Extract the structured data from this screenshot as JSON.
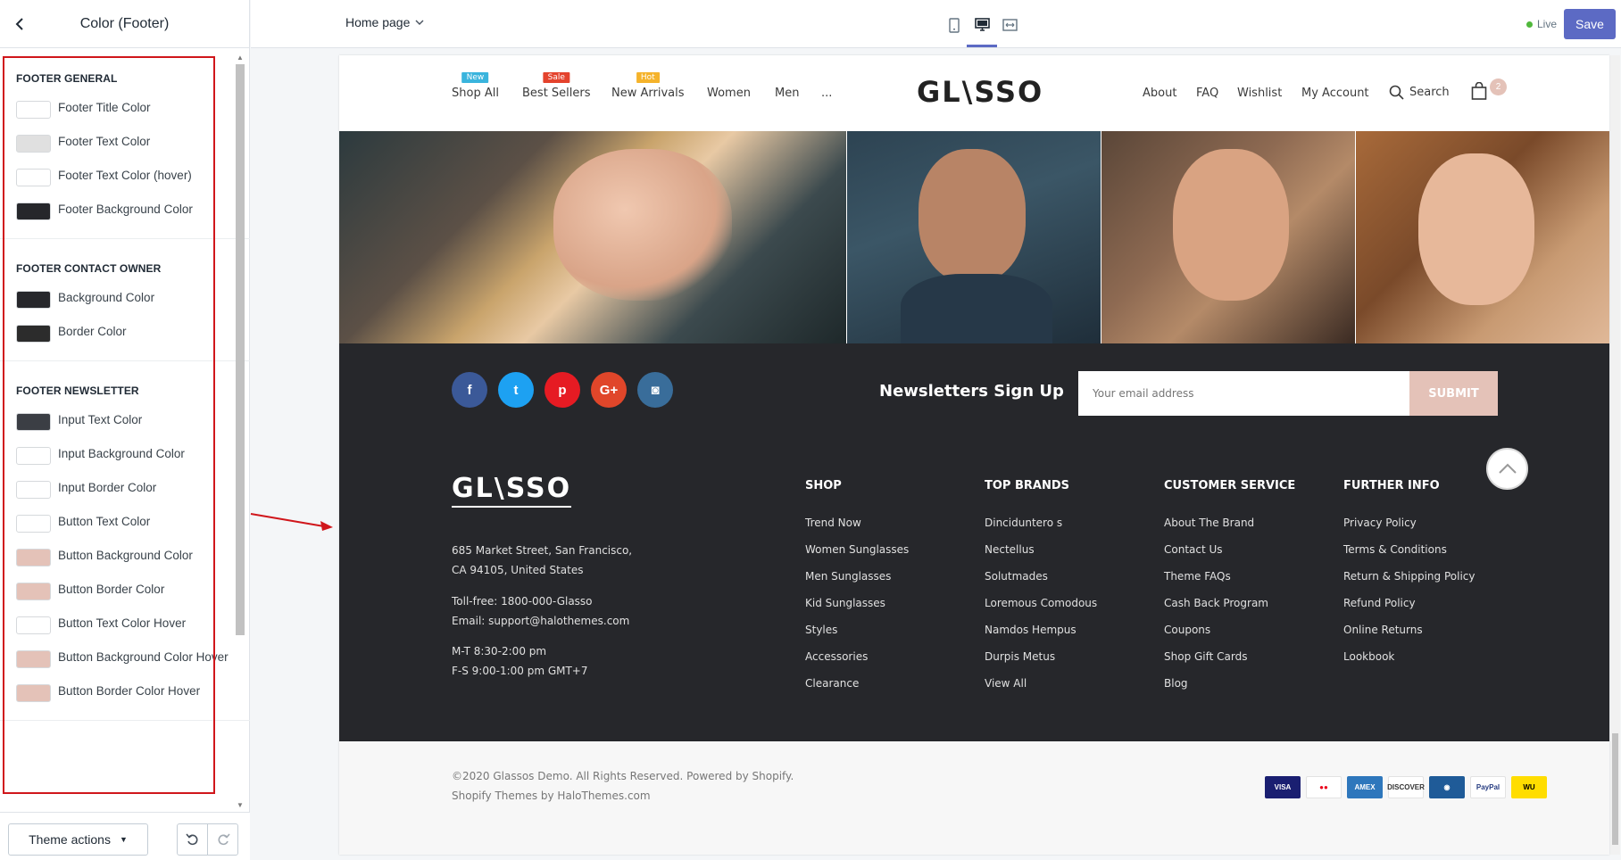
{
  "sidebar": {
    "title": "Color (Footer)",
    "sections": [
      {
        "title": "FOOTER GENERAL",
        "items": [
          {
            "label": "Footer Title Color",
            "color": "#ffffff"
          },
          {
            "label": "Footer Text Color",
            "color": "#e0e0e0"
          },
          {
            "label": "Footer Text Color (hover)",
            "color": "#ffffff"
          },
          {
            "label": "Footer Background Color",
            "color": "#26272b"
          }
        ]
      },
      {
        "title": "FOOTER CONTACT OWNER",
        "items": [
          {
            "label": "Background Color",
            "color": "#26272b"
          },
          {
            "label": "Border Color",
            "color": "#2c2c2c"
          }
        ]
      },
      {
        "title": "FOOTER NEWSLETTER",
        "items": [
          {
            "label": "Input Text Color",
            "color": "#3b3e44"
          },
          {
            "label": "Input Background Color",
            "color": "#ffffff"
          },
          {
            "label": "Input Border Color",
            "color": "#ffffff"
          },
          {
            "label": "Button Text Color",
            "color": "#ffffff"
          },
          {
            "label": "Button Background Color",
            "color": "#e4c2b8"
          },
          {
            "label": "Button Border Color",
            "color": "#e4c2b8"
          },
          {
            "label": "Button Text Color Hover",
            "color": "#ffffff"
          },
          {
            "label": "Button Background Color Hover",
            "color": "#e4c2b8"
          },
          {
            "label": "Button Border Color Hover",
            "color": "#e4c2b8"
          }
        ]
      }
    ],
    "theme_actions_label": "Theme actions"
  },
  "topbar": {
    "page_select": "Home page",
    "live_label": "Live",
    "save_label": "Save"
  },
  "store": {
    "nav": [
      {
        "label": "Shop All",
        "badge": "New",
        "badge_color": "#3ab4dd"
      },
      {
        "label": "Best Sellers",
        "badge": "Sale",
        "badge_color": "#e4432d"
      },
      {
        "label": "New Arrivals",
        "badge": "Hot",
        "badge_color": "#f5b32b"
      },
      {
        "label": "Women",
        "badge": "",
        "badge_color": ""
      },
      {
        "label": "Men",
        "badge": "",
        "badge_color": ""
      },
      {
        "label": "...",
        "badge": "",
        "badge_color": ""
      }
    ],
    "logo": "GL\\SSO",
    "utility": {
      "about": "About",
      "faq": "FAQ",
      "wishlist": "Wishlist",
      "account": "My Account",
      "search": "Search",
      "cart_count": "2"
    },
    "newsletter": {
      "title": "Newsletters Sign Up",
      "placeholder": "Your email address",
      "submit": "SUBMIT"
    },
    "social": [
      {
        "name": "facebook-icon",
        "glyph": "f",
        "color": "#3b5998"
      },
      {
        "name": "twitter-icon",
        "glyph": "t",
        "color": "#1da1f2"
      },
      {
        "name": "pinterest-icon",
        "glyph": "p",
        "color": "#e61b23"
      },
      {
        "name": "google-plus-icon",
        "glyph": "G+",
        "color": "#e0462a"
      },
      {
        "name": "instagram-icon",
        "glyph": "◙",
        "color": "#396d9a"
      }
    ],
    "footer_logo": "GL\\SSO",
    "address": {
      "line1": "685 Market Street, San Francisco,",
      "line2": "CA 94105, United States",
      "phone": "Toll-free: 1800-000-Glasso",
      "email": "Email: support@halothemes.com",
      "hours1": "M-T 8:30-2:00 pm",
      "hours2": "F-S 9:00-1:00 pm GMT+7"
    },
    "columns": [
      {
        "title": "SHOP",
        "links": [
          "Trend Now",
          "Women Sunglasses",
          "Men Sunglasses",
          "Kid Sunglasses",
          "Styles",
          "Accessories",
          "Clearance"
        ]
      },
      {
        "title": "TOP BRANDS",
        "links": [
          "Dinciduntero s",
          "Nectellus",
          "Solutmades",
          "Loremous Comodous",
          "Namdos Hempus",
          "Durpis Metus",
          "View All"
        ]
      },
      {
        "title": "CUSTOMER SERVICE",
        "links": [
          "About The Brand",
          "Contact Us",
          "Theme FAQs",
          "Cash Back Program",
          "Coupons",
          "Shop Gift Cards",
          "Blog"
        ]
      },
      {
        "title": "FURTHER INFO",
        "links": [
          "Privacy Policy",
          "Terms & Conditions",
          "Return & Shipping Policy",
          "Refund Policy",
          "Online Returns",
          "Lookbook"
        ]
      }
    ],
    "copyright1": "©2020 Glassos Demo. All Rights Reserved. Powered by Shopify.",
    "copyright2": "Shopify Themes by HaloThemes.com",
    "payments": [
      {
        "name": "visa-icon",
        "label": "VISA",
        "bg": "#1a1f71",
        "fg": "#ffffff"
      },
      {
        "name": "mastercard-icon",
        "label": "●●",
        "bg": "#ffffff",
        "fg": "#eb001b"
      },
      {
        "name": "amex-icon",
        "label": "AMEX",
        "bg": "#2e77bc",
        "fg": "#ffffff"
      },
      {
        "name": "discover-icon",
        "label": "DISCOVER",
        "bg": "#ffffff",
        "fg": "#333333"
      },
      {
        "name": "generic-card-icon",
        "label": "◉",
        "bg": "#1f5b98",
        "fg": "#ffffff"
      },
      {
        "name": "paypal-icon",
        "label": "PayPal",
        "bg": "#ffffff",
        "fg": "#253b80"
      },
      {
        "name": "western-union-icon",
        "label": "WU",
        "bg": "#ffdd00",
        "fg": "#000000"
      }
    ]
  }
}
